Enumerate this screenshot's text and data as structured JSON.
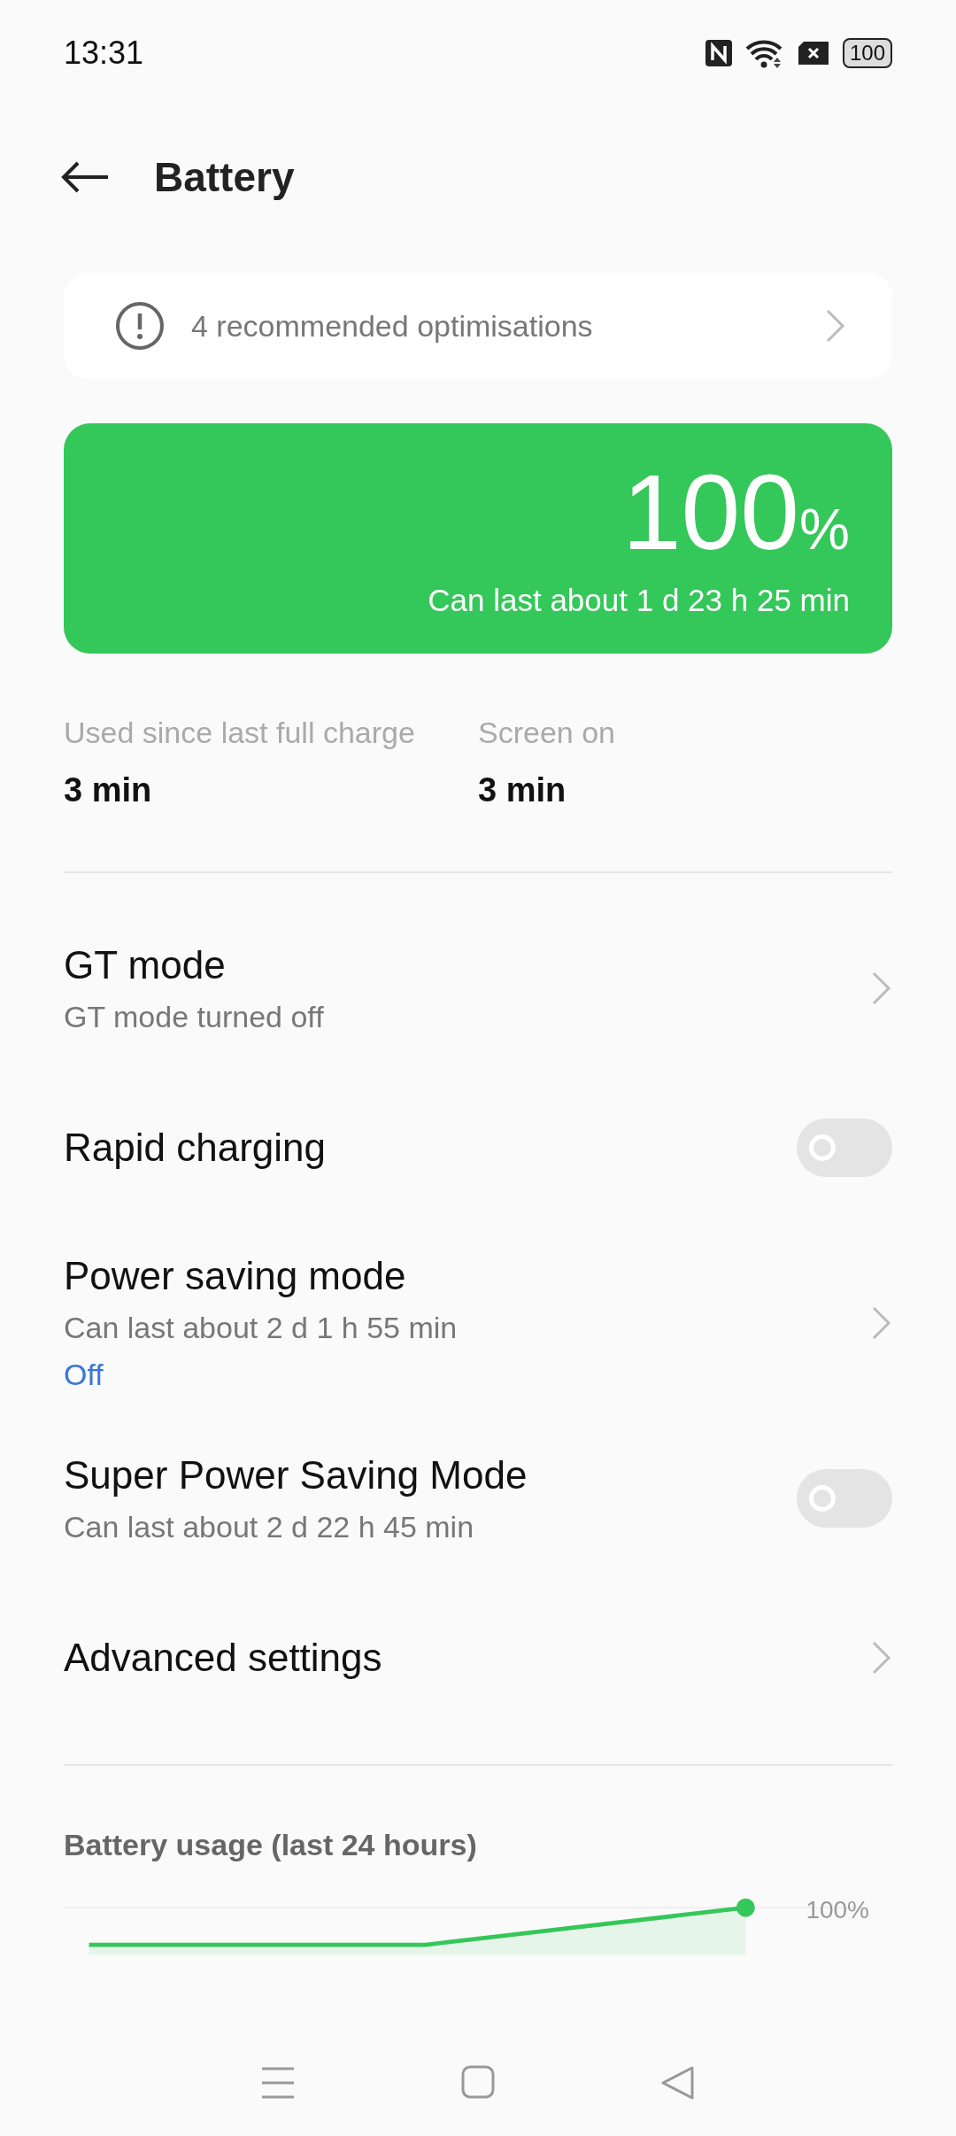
{
  "status_bar": {
    "time": "13:31",
    "battery": "100"
  },
  "header": {
    "title": "Battery"
  },
  "recommendation": {
    "text": "4 recommended optimisations"
  },
  "battery_card": {
    "percent": "100",
    "unit": "%",
    "estimate": "Can last about 1 d 23 h 25 min"
  },
  "usage_stats": [
    {
      "label": "Used since last full charge",
      "value": "3 min"
    },
    {
      "label": "Screen on",
      "value": "3 min"
    }
  ],
  "settings": [
    {
      "kind": "link",
      "title": "GT mode",
      "subtitle": "GT mode turned off"
    },
    {
      "kind": "toggle",
      "title": "Rapid charging",
      "on": false
    },
    {
      "kind": "link",
      "title": "Power saving mode",
      "subtitle": "Can last about 2 d 1 h 55 min",
      "status": "Off"
    },
    {
      "kind": "toggle",
      "title": "Super Power Saving Mode",
      "subtitle": "Can last about 2 d 22 h 45 min",
      "on": false
    },
    {
      "kind": "link",
      "title": "Advanced settings"
    }
  ],
  "usage_chart": {
    "title": "Battery usage (last 24 hours)",
    "level_label": "100%"
  }
}
